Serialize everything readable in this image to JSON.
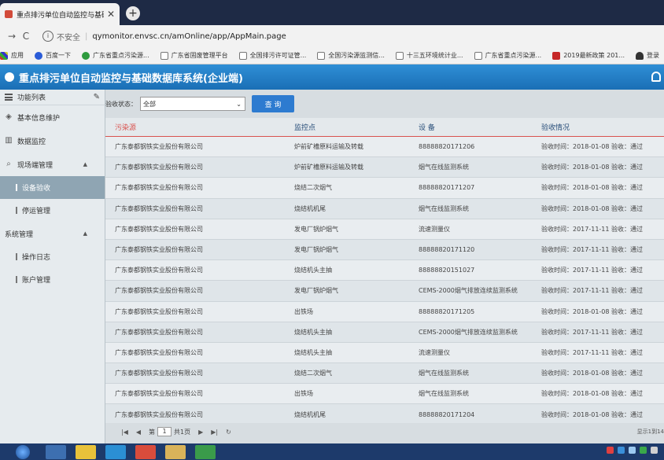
{
  "browser": {
    "tab_title": "重点排污单位自动监控与基础数",
    "insecure_label": "不安全",
    "url": "qymonitor.envsc.cn/amOnline/app/AppMain.page",
    "bookmarks": [
      {
        "label": "应用",
        "icon": "apps-icon"
      },
      {
        "label": "百度一下",
        "icon": "baidu-icon"
      },
      {
        "label": "广东省重点污染源...",
        "icon": "site-icon"
      },
      {
        "label": "广东省固废管理平台",
        "icon": "doc-icon"
      },
      {
        "label": "全国排污许可证管...",
        "icon": "doc-icon"
      },
      {
        "label": "全国污染源监测信...",
        "icon": "doc-icon"
      },
      {
        "label": "十三五环境统计业...",
        "icon": "doc-icon"
      },
      {
        "label": "广东省重点污染源...",
        "icon": "doc-icon"
      },
      {
        "label": "2019最新政策 201...",
        "icon": "doc-icon"
      },
      {
        "label": "登录",
        "icon": "cap-icon"
      }
    ]
  },
  "app": {
    "title": "重点排污单位自动监控与基础数据库系统(企业端)"
  },
  "sidebar": {
    "header_label": "功能列表",
    "items": {
      "basic_info": "基本信息维护",
      "data_monitor": "数据监控",
      "field_mgmt": "现场端管理",
      "equip_accept": "设备验收",
      "stop_mgmt": "停运管理",
      "sys_mgmt": "系统管理",
      "op_log": "操作日志",
      "account_mgmt": "账户管理"
    }
  },
  "filter": {
    "label": "验收状态：",
    "selected": "全部",
    "query_button": "查 询"
  },
  "table": {
    "headers": [
      "污染源",
      "监控点",
      "设 备",
      "验收情况"
    ],
    "rows": [
      [
        "广东泰都钢铁实业股份有限公司",
        "炉前矿槽原料运输及转载",
        "88888820171206",
        "验收时间：2018-01-08  验收：通过"
      ],
      [
        "广东泰都钢铁实业股份有限公司",
        "炉前矿槽原料运输及转载",
        "烟气在线监测系统",
        "验收时间：2018-01-08  验收：通过"
      ],
      [
        "广东泰都钢铁实业股份有限公司",
        "烧结二次烟气",
        "88888820171207",
        "验收时间：2018-01-08  验收：通过"
      ],
      [
        "广东泰都钢铁实业股份有限公司",
        "烧结机机尾",
        "烟气在线监测系统",
        "验收时间：2018-01-08  验收：通过"
      ],
      [
        "广东泰都钢铁实业股份有限公司",
        "发电厂锅炉烟气",
        "流速测量仪",
        "验收时间：2017-11-11  验收：通过"
      ],
      [
        "广东泰都钢铁实业股份有限公司",
        "发电厂锅炉烟气",
        "88888820171120",
        "验收时间：2017-11-11  验收：通过"
      ],
      [
        "广东泰都钢铁实业股份有限公司",
        "烧结机头主抽",
        "88888820151027",
        "验收时间：2017-11-11  验收：通过"
      ],
      [
        "广东泰都钢铁实业股份有限公司",
        "发电厂锅炉烟气",
        "CEMS-2000烟气排放连续监测系统",
        "验收时间：2017-11-11  验收：通过"
      ],
      [
        "广东泰都钢铁实业股份有限公司",
        "出铁场",
        "88888820171205",
        "验收时间：2018-01-08  验收：通过"
      ],
      [
        "广东泰都钢铁实业股份有限公司",
        "烧结机头主抽",
        "CEMS-2000烟气排放连续监测系统",
        "验收时间：2017-11-11  验收：通过"
      ],
      [
        "广东泰都钢铁实业股份有限公司",
        "烧结机头主抽",
        "流速测量仪",
        "验收时间：2017-11-11  验收：通过"
      ],
      [
        "广东泰都钢铁实业股份有限公司",
        "烧结二次烟气",
        "烟气在线监测系统",
        "验收时间：2018-01-08  验收：通过"
      ],
      [
        "广东泰都钢铁实业股份有限公司",
        "出铁场",
        "烟气在线监测系统",
        "验收时间：2018-01-08  验收：通过"
      ],
      [
        "广东泰都钢铁实业股份有限公司",
        "烧结机机尾",
        "88888820171204",
        "验收时间：2018-01-08  验收：通过"
      ]
    ]
  },
  "pager": {
    "page_prefix": "第",
    "page_value": "1",
    "page_suffix": "共1页",
    "info": "显示1到14"
  },
  "colors": {
    "header_blue": "#1a6fb5",
    "query_button": "#2d7bd0",
    "accent_red": "#d9534f",
    "sidebar_active": "#8fa5b3"
  }
}
